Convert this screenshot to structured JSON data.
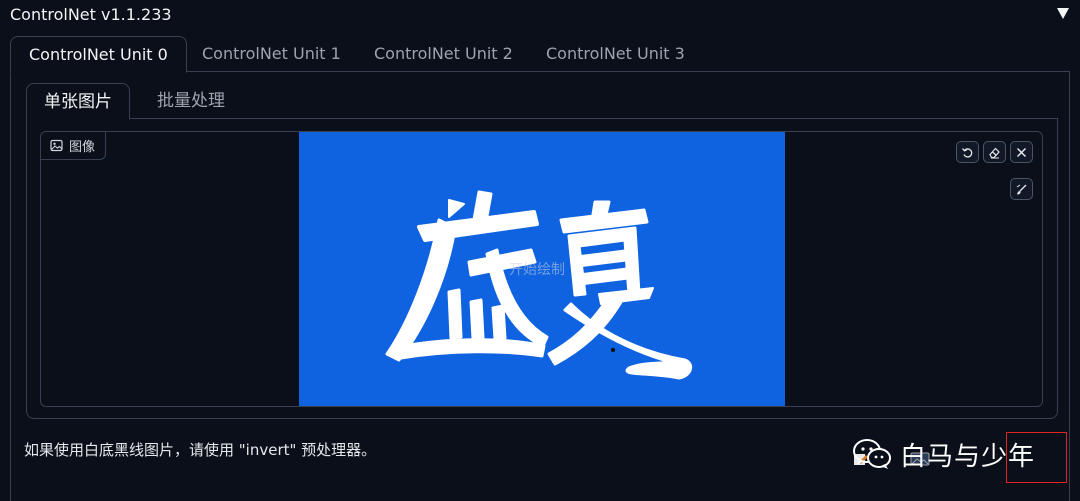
{
  "header": {
    "title": "ControlNet v1.1.233",
    "collapse_icon": "triangle-down-icon"
  },
  "unit_tabs": [
    {
      "label": "ControlNet Unit 0",
      "active": true
    },
    {
      "label": "ControlNet Unit 1",
      "active": false
    },
    {
      "label": "ControlNet Unit 2",
      "active": false
    },
    {
      "label": "ControlNet Unit 3",
      "active": false
    }
  ],
  "mode_tabs": [
    {
      "label": "单张图片",
      "active": true
    },
    {
      "label": "批量处理",
      "active": false
    }
  ],
  "image_block": {
    "label": "图像",
    "label_icon": "image-icon",
    "canvas_background": "#0f62e0",
    "canvas_image": "盛夏",
    "overlay_text": "开始绘制",
    "tools": [
      {
        "name": "undo-button",
        "icon": "undo-icon"
      },
      {
        "name": "eraser-button",
        "icon": "eraser-icon"
      },
      {
        "name": "clear-button",
        "icon": "close-icon"
      },
      {
        "name": "brush-button",
        "icon": "brush-icon"
      }
    ]
  },
  "hint": "如果使用白底黑线图片，请使用 \"invert\" 预处理器。",
  "watermark": {
    "icon": "wechat-icon",
    "text": "白马与少年"
  },
  "colors": {
    "background": "#0b0f19",
    "border": "#374151",
    "canvas": "#0f62e0",
    "highlight_box": "#e02424"
  }
}
